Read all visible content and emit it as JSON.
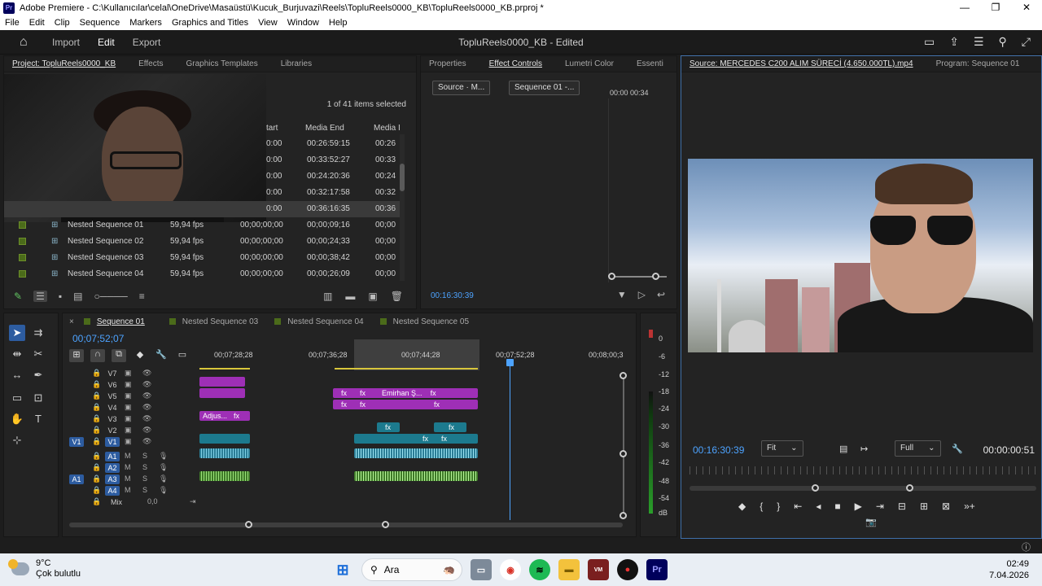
{
  "titlebar": {
    "app_icon": "Pr",
    "title": "Adobe Premiere - C:\\Kullanıcılar\\celal\\OneDrive\\Masaüstü\\Kucuk_Burjuvazi\\Reels\\TopluReels0000_KB\\TopluReels0000_KB.prproj *",
    "minimize": "—",
    "maximize": "❐",
    "close": "✕"
  },
  "menu": [
    "File",
    "Edit",
    "Clip",
    "Sequence",
    "Markers",
    "Graphics and Titles",
    "View",
    "Window",
    "Help"
  ],
  "header": {
    "tabs": [
      {
        "label": "Import"
      },
      {
        "label": "Edit"
      },
      {
        "label": "Export"
      }
    ],
    "document_title": "TopluReels0000_KB - Edited"
  },
  "project_panel": {
    "tabs": [
      "Project: TopluReels0000_KB",
      "Effects",
      "Graphics Templates",
      "Libraries"
    ],
    "selection_count": "1 of 41 items selected",
    "columns": [
      "tart",
      "Media End",
      "Media I"
    ],
    "rows_partial": [
      {
        "start": "0:00",
        "end": "00:26:59:15",
        "dur": "00:26"
      },
      {
        "start": "0:00",
        "end": "00:33:52:27",
        "dur": "00:33"
      },
      {
        "start": "0:00",
        "end": "00:24:20:36",
        "dur": "00:24"
      },
      {
        "start": "0:00",
        "end": "00:32:17:58",
        "dur": "00:32"
      },
      {
        "start": "0:00",
        "end": "00:36:16:35",
        "dur": "00:36"
      }
    ],
    "rows": [
      {
        "name": "Nested Sequence 01",
        "fps": "59,94 fps",
        "start": "00;00;00;00",
        "end": "00;00;09;16",
        "dur": "00;00"
      },
      {
        "name": "Nested Sequence 02",
        "fps": "59,94 fps",
        "start": "00;00;00;00",
        "end": "00;00;24;33",
        "dur": "00;00"
      },
      {
        "name": "Nested Sequence 03",
        "fps": "59,94 fps",
        "start": "00;00;00;00",
        "end": "00;00;38;42",
        "dur": "00;00"
      },
      {
        "name": "Nested Sequence 04",
        "fps": "59,94 fps",
        "start": "00;00;00;00",
        "end": "00;00;26;09",
        "dur": "00;00"
      }
    ]
  },
  "effect_controls": {
    "tabs": [
      "Properties",
      "Effect Controls",
      "Lumetri Color",
      "Essenti"
    ],
    "source_btn": "Source · M...",
    "sequence_btn": "Sequence 01 -...",
    "mini_times": "00:00  00:34",
    "timecode": "00:16:30:39"
  },
  "source_monitor": {
    "tabs": [
      "Source: MERCEDES C200 ALIM SÜRECİ (4.650.000TL).mp4",
      "Program: Sequence 01"
    ],
    "timecode": "00:16:30:39",
    "zoom": "Fit",
    "resolution": "Full",
    "duration": "00:00:00:51"
  },
  "timeline": {
    "tabs": [
      {
        "label": "Sequence 01",
        "active": true
      },
      {
        "label": "Nested Sequence 03"
      },
      {
        "label": "Nested Sequence 04"
      },
      {
        "label": "Nested Sequence 05"
      }
    ],
    "timecode": "00;07;52;07",
    "ruler": [
      "00;07;28;28",
      "00;07;36;28",
      "00;07;44;28",
      "00;07;52;28",
      "00;08;00;3"
    ],
    "video_tracks": [
      "V7",
      "V6",
      "V5",
      "V4",
      "V3",
      "V2",
      "V1"
    ],
    "audio_tracks": [
      "A1",
      "A2",
      "A3",
      "A4"
    ],
    "src_v": "V1",
    "src_a": "A1",
    "mix_label": "Mix",
    "mix_value": "0,0",
    "clip_labels": {
      "emirhan": "Emirhan Ş...",
      "adjust": "Adjus...",
      "fx": "fx"
    }
  },
  "meter": {
    "scale": [
      "0",
      "-6",
      "-12",
      "-18",
      "-24",
      "-30",
      "-36",
      "-42",
      "-48",
      "-54",
      "dB"
    ]
  },
  "taskbar": {
    "temp": "9°C",
    "weather": "Çok bulutlu",
    "search": "Ara",
    "time": "02:49",
    "date": "7.04.2026",
    "apps": [
      "Pr"
    ]
  }
}
